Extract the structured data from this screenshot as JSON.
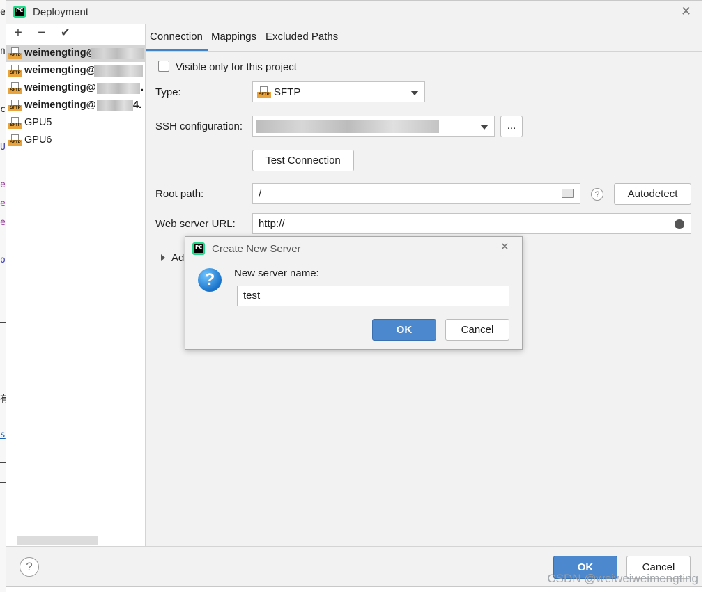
{
  "window": {
    "title": "Deployment"
  },
  "toolbar": {
    "add": "+",
    "remove": "−",
    "apply": "✔"
  },
  "servers": [
    {
      "name": "weimengting@",
      "selected": true,
      "bold": true,
      "tail": ""
    },
    {
      "name": "weimengting@",
      "selected": false,
      "bold": true,
      "tail": ""
    },
    {
      "name": "weimengting@",
      "selected": false,
      "bold": true,
      "tail": "."
    },
    {
      "name": "weimengting@",
      "selected": false,
      "bold": true,
      "tail": "4."
    },
    {
      "name": "GPU5",
      "selected": false,
      "bold": false,
      "tail": ""
    },
    {
      "name": "GPU6",
      "selected": false,
      "bold": false,
      "tail": ""
    }
  ],
  "icon_tag": "SFTP",
  "tabs": [
    "Connection",
    "Mappings",
    "Excluded Paths"
  ],
  "form": {
    "visible_only": "Visible only for this project",
    "type_label": "Type:",
    "type_value": "SFTP",
    "ssh_label": "SSH configuration:",
    "ssh_more": "...",
    "test_connection": "Test Connection",
    "root_label": "Root path:",
    "root_value": "/",
    "autodetect": "Autodetect",
    "web_label": "Web server URL:",
    "web_value": "http://",
    "advanced_partial": "Ad"
  },
  "modal": {
    "title": "Create New Server",
    "prompt": "New server name:",
    "input_value": "test",
    "ok": "OK",
    "cancel": "Cancel"
  },
  "footer": {
    "help": "?",
    "ok": "OK",
    "cancel": "Cancel"
  },
  "watermark": "CSDN @weiweiweimengting",
  "colors": {
    "accent": "#4c88cd",
    "tab_underline": "#4083c9",
    "sftp_tag": "#e8a33d",
    "app_icon": "#21d789"
  }
}
